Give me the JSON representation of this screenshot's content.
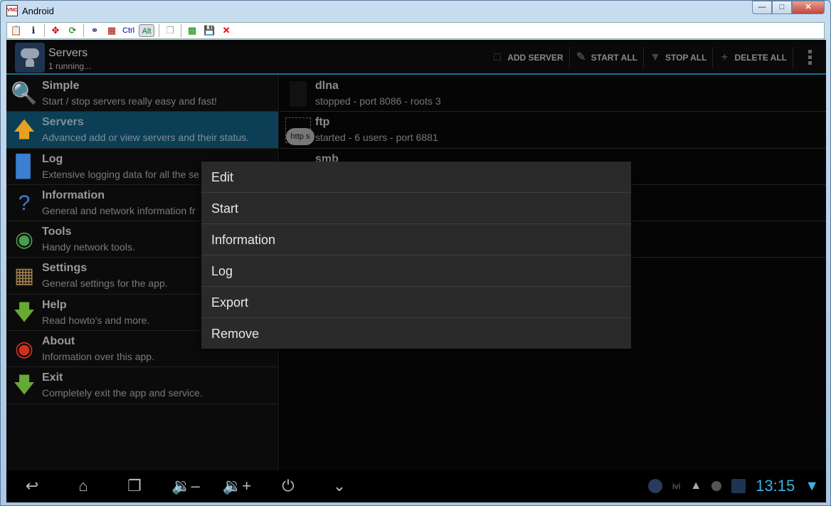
{
  "window": {
    "title": "Android",
    "buttons": [
      "minimize",
      "maximize",
      "close"
    ]
  },
  "vnc_toolbar": {
    "items": [
      "options-icon",
      "info-icon",
      "fullscreen-icon",
      "refresh-icon",
      "ctrl-alt-del-icon",
      "start-menu-icon"
    ],
    "ctrl_label": "Ctrl",
    "alt_label": "Alt",
    "items2": [
      "copy-icon",
      "transfer-icon",
      "save-icon",
      "disconnect-icon"
    ]
  },
  "actionbar": {
    "title": "Servers",
    "subtitle": "1 running...",
    "actions": [
      {
        "label": "ADD SERVER",
        "icon": "add-server-icon"
      },
      {
        "label": "START ALL",
        "icon": "pencil-icon"
      },
      {
        "label": "STOP ALL",
        "icon": "thumb-down-icon"
      },
      {
        "label": "DELETE ALL",
        "icon": "plus-icon"
      }
    ],
    "accent": "#1d6f8f"
  },
  "nav": [
    {
      "title": "Simple",
      "subtitle": "Start / stop servers really easy and fast!",
      "icon": "magnifier-icon"
    },
    {
      "title": "Servers",
      "subtitle": "Advanced add or view servers and their status.",
      "icon": "arrow-up-icon",
      "selected": true
    },
    {
      "title": "Log",
      "subtitle": "Extensive logging data for all the se",
      "icon": "bar-chart-icon"
    },
    {
      "title": "Information",
      "subtitle": "General and network information fr",
      "icon": "question-icon"
    },
    {
      "title": "Tools",
      "subtitle": "Handy network tools.",
      "icon": "globe-icon"
    },
    {
      "title": "Settings",
      "subtitle": "General settings for the app.",
      "icon": "settings-icon"
    },
    {
      "title": "Help",
      "subtitle": "Read howto's and more.",
      "icon": "arrow-down-icon"
    },
    {
      "title": "About",
      "subtitle": "Information over this app.",
      "icon": "about-icon"
    },
    {
      "title": "Exit",
      "subtitle": "Completely exit the app and service.",
      "icon": "exit-arrow-icon"
    }
  ],
  "servers": [
    {
      "name": "dlna",
      "status": "stopped - port 8086 - roots 3"
    },
    {
      "name": "ftp",
      "status": "started - 6 users - port 6881",
      "icon_text": "http s"
    },
    {
      "name": "smb",
      "status": ""
    }
  ],
  "context_menu": [
    "Edit",
    "Start",
    "Information",
    "Log",
    "Export",
    "Remove"
  ],
  "navbar": {
    "buttons": [
      "back-icon",
      "home-icon",
      "recents-icon",
      "volume-down-icon",
      "volume-up-icon",
      "power-icon",
      "collapse-icon"
    ],
    "clock": "13:15",
    "tray_text": "ivi",
    "clock_color": "#36b5e5"
  }
}
